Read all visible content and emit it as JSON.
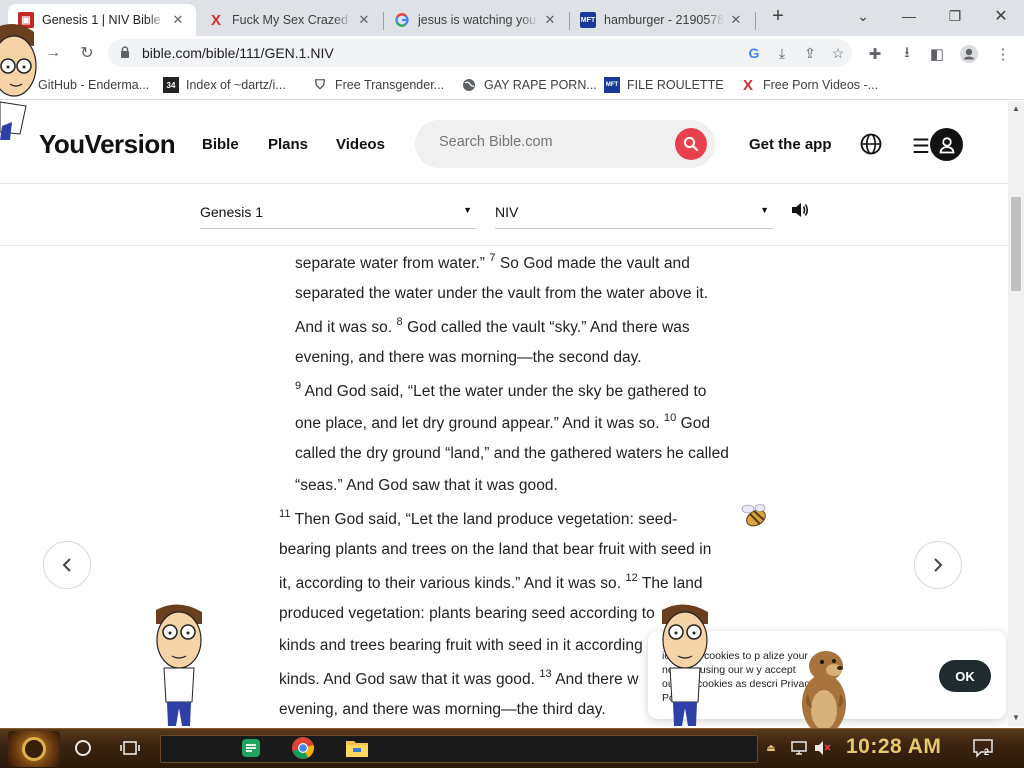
{
  "browser": {
    "tabs": [
      {
        "title": "Genesis 1 | NIV Bible",
        "favicon": "bible-icon",
        "active": true
      },
      {
        "title": "Fuck My Sex Crazed",
        "favicon": "x-red-icon",
        "active": false
      },
      {
        "title": "jesus is watching you",
        "favicon": "google-icon",
        "active": false
      },
      {
        "title": "hamburger - 2190578",
        "favicon": "mft-icon",
        "active": false
      }
    ],
    "new_tab": "+",
    "url": "bible.com/bible/111/GEN.1.NIV",
    "bookmarks": [
      {
        "label": "GitHub - Enderma...",
        "icon": "user-icon"
      },
      {
        "label": "Index of ~dartz/i...",
        "icon": "yugioh-icon"
      },
      {
        "label": "Free Transgender...",
        "icon": "shield-icon"
      },
      {
        "label": "GAY RAPE PORN...",
        "icon": "globe-icon"
      },
      {
        "label": "FILE ROULETTE",
        "icon": "mft-icon"
      },
      {
        "label": "Free Porn Videos -...",
        "icon": "x-red-icon"
      }
    ]
  },
  "site": {
    "logo": "YouVersion",
    "nav": [
      "Bible",
      "Plans",
      "Videos"
    ],
    "search_placeholder": "Search Bible.com",
    "get_app": "Get the app",
    "accent": "#e8414d"
  },
  "reader": {
    "book_chapter": "Genesis 1",
    "version": "NIV",
    "lines": [
      {
        "segments": [
          {
            "t": "separate water from water.” "
          },
          {
            "sup": "7"
          },
          {
            "t": " So God made the vault and"
          }
        ]
      },
      {
        "segments": [
          {
            "t": "separated the water under the vault from the water above it."
          }
        ]
      },
      {
        "segments": [
          {
            "t": "And it was so. "
          },
          {
            "sup": "8"
          },
          {
            "t": " God called the vault “sky.” And there was"
          }
        ]
      },
      {
        "segments": [
          {
            "t": "evening, and there was morning—the second day."
          }
        ]
      },
      {
        "segments": [
          {
            "sup": "9"
          },
          {
            "t": " And God said, “Let the water under the sky be gathered to"
          }
        ]
      },
      {
        "segments": [
          {
            "t": "one place, and let dry ground appear.” And it was so. "
          },
          {
            "sup": "10"
          },
          {
            "t": " God"
          }
        ]
      },
      {
        "segments": [
          {
            "t": "called the dry ground “land,” and the gathered waters he called"
          }
        ]
      },
      {
        "segments": [
          {
            "t": "“seas.” And God saw that it was good."
          }
        ]
      },
      {
        "segments": [
          {
            "sup": "11"
          },
          {
            "t": " Then God said, “Let the land produce vegetation: seed-"
          }
        ]
      },
      {
        "segments": [
          {
            "t": "bearing plants and trees on the land that bear fruit with seed in"
          }
        ]
      },
      {
        "segments": [
          {
            "t": "it, according to their various kinds.” And it was so. "
          },
          {
            "sup": "12"
          },
          {
            "t": " The land"
          }
        ]
      },
      {
        "segments": [
          {
            "t": "produced vegetation: plants bearing seed according to"
          }
        ]
      },
      {
        "segments": [
          {
            "t": "kinds and trees bearing fruit with seed in it according"
          }
        ]
      },
      {
        "segments": [
          {
            "t": "kinds. And God saw that it was good. "
          },
          {
            "sup": "13"
          },
          {
            "t": " And there w"
          }
        ]
      },
      {
        "segments": [
          {
            "t": "evening, and there was morning—the third day."
          }
        ]
      }
    ]
  },
  "cookie": {
    "line1": "ion uses cookies to p  alize your",
    "line2": "nce. By using our w   y accept",
    "line3": "ou   e of cookies as descri        Privacy",
    "line4": "Po",
    "ok": "OK"
  },
  "taskbar": {
    "clock": "10:28 AM",
    "notification_count": "2"
  }
}
